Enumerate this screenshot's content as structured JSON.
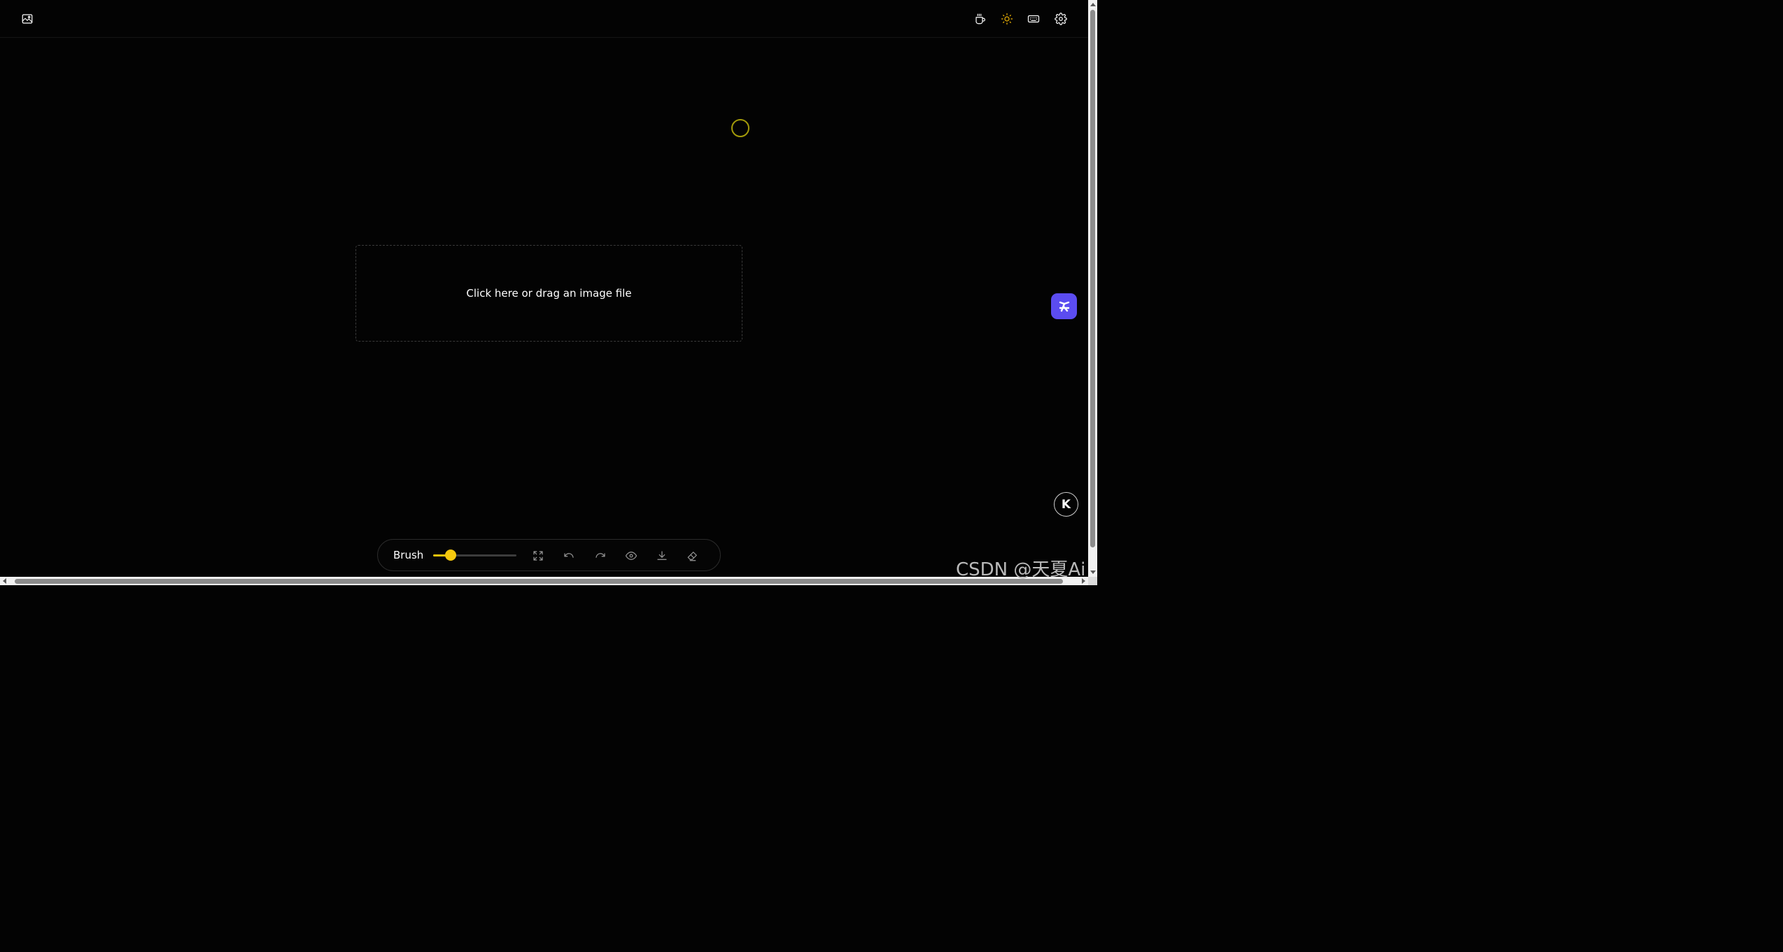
{
  "topbar": {
    "left_icon": "image-icon",
    "right_icons": [
      "coffee-icon",
      "sun-icon",
      "keyboard-icon",
      "gear-icon"
    ]
  },
  "dropzone": {
    "text": "Click here or drag an image file"
  },
  "toolbar": {
    "brush_label": "Brush",
    "brush_size_fraction": 0.21,
    "icons": [
      "expand-icon",
      "undo-icon",
      "redo-icon",
      "eye-icon",
      "download-icon",
      "eraser-icon"
    ]
  },
  "floating": {
    "app_icon": "app-launcher-icon",
    "k_label": "K"
  },
  "watermark": {
    "text": "CSDN @天夏Ai"
  },
  "colors": {
    "accent": "#f6c90e",
    "background": "#030303",
    "app_badge": "#5b4cf0"
  }
}
